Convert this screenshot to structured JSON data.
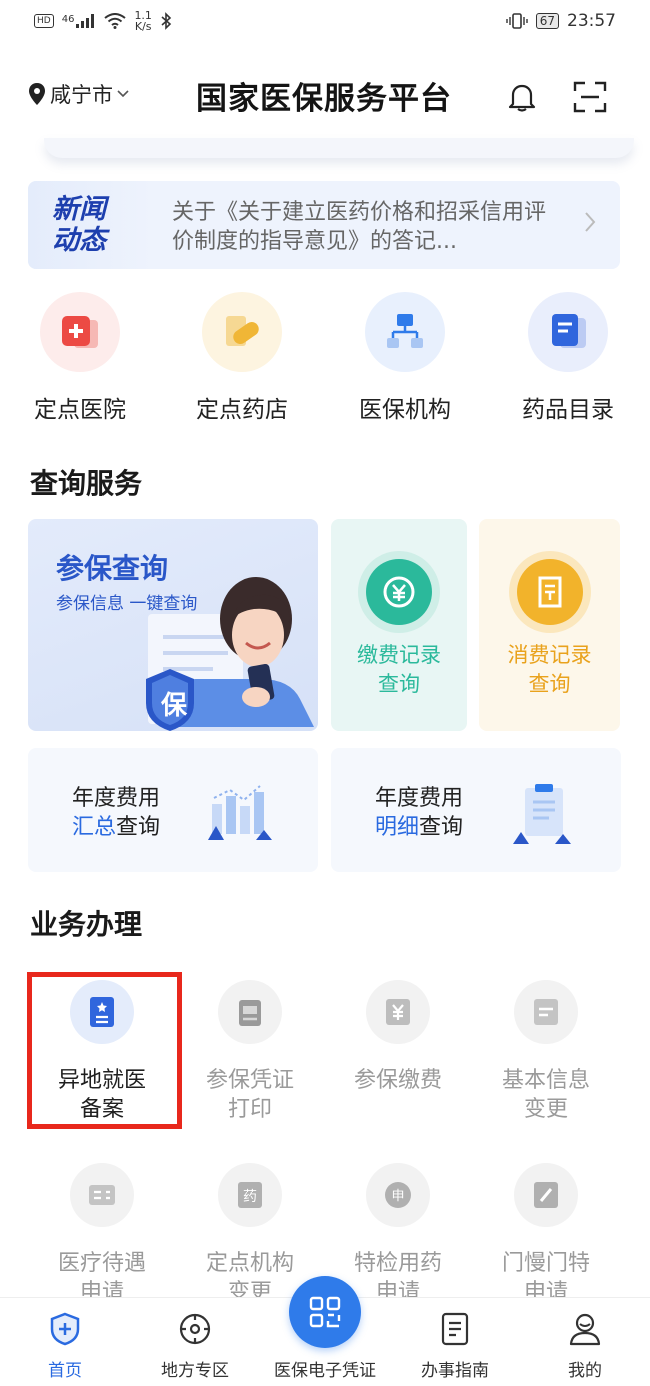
{
  "status_bar": {
    "hd": "HD",
    "network": "46",
    "speed_value": "1.1",
    "speed_unit": "K/s",
    "battery": "67",
    "time": "23:57"
  },
  "header": {
    "city": "咸宁市",
    "title": "国家医保服务平台"
  },
  "news": {
    "tag_line1": "新闻",
    "tag_line2": "动态",
    "text": "关于《关于建立医药价格和招采信用评价制度的指导意见》的答记..."
  },
  "quick_links": [
    {
      "label": "定点医院",
      "icon": "hospital-icon"
    },
    {
      "label": "定点药店",
      "icon": "pill-icon"
    },
    {
      "label": "医保机构",
      "icon": "org-chart-icon"
    },
    {
      "label": "药品目录",
      "icon": "catalog-icon"
    }
  ],
  "query_section": {
    "title": "查询服务",
    "main_card": {
      "title": "参保查询",
      "subtitle": "参保信息 一键查询",
      "badge": "保"
    },
    "pay_card": {
      "line1": "缴费记录",
      "line2": "查询",
      "color": "#2bb99b"
    },
    "spend_card": {
      "line1": "消费记录",
      "line2": "查询",
      "color": "#e9a21c"
    },
    "year_summary": {
      "line1": "年度费用",
      "highlight": "汇总",
      "rest": "查询"
    },
    "year_detail": {
      "line1": "年度费用",
      "highlight": "明细",
      "rest": "查询"
    }
  },
  "business_section": {
    "title": "业务办理",
    "items": [
      {
        "line1": "异地就医",
        "line2": "备案",
        "icon": "id-card-icon",
        "active": true
      },
      {
        "line1": "参保凭证",
        "line2": "打印",
        "icon": "printer-icon"
      },
      {
        "line1": "参保缴费",
        "line2": "",
        "icon": "yuan-icon"
      },
      {
        "line1": "基本信息",
        "line2": "变更",
        "icon": "info-card-icon"
      },
      {
        "line1": "医疗待遇",
        "line2": "申请",
        "icon": "form-icon"
      },
      {
        "line1": "定点机构",
        "line2": "变更",
        "icon": "medicine-icon"
      },
      {
        "line1": "特检用药",
        "line2": "申请",
        "icon": "apply-icon"
      },
      {
        "line1": "门慢门特",
        "line2": "申请",
        "icon": "edit-icon"
      }
    ]
  },
  "bottom_nav": {
    "home": "首页",
    "local": "地方专区",
    "ecard": "医保电子凭证",
    "guide": "办事指南",
    "mine": "我的"
  },
  "colors": {
    "accent": "#2a6ae0",
    "highlight_box": "#e8281c"
  }
}
